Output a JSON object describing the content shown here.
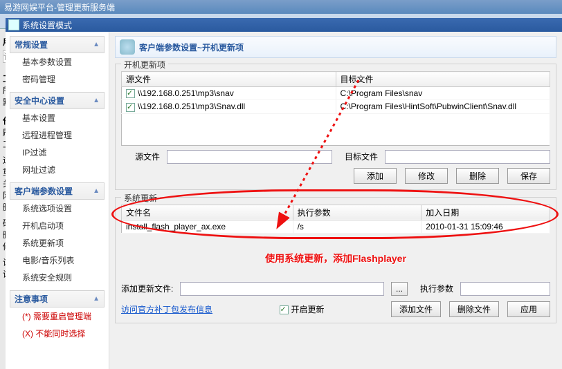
{
  "app_title": "易游网娱平台-管理更新服务端",
  "modal_title": "系统设置模式",
  "left": {
    "user_hdr": "用户设",
    "input_ph": "请输",
    "sect1": "工作纟",
    "l1": "所有工",
    "l2": "默认纟",
    "sect2": "任务",
    "l3": "刷新工",
    "l4": "工作纟",
    "l5": "运行和",
    "l6": "重启工",
    "l7": "关闭工",
    "l8": "网络发",
    "l9": "删除文",
    "l10": "硬盘保",
    "l11": "删除工",
    "l12": "修改工",
    "l13": "设备和",
    "l14": "设备管"
  },
  "sidebar": {
    "g1": "常规设置",
    "g1_items": [
      "基本参数设置",
      "密码管理"
    ],
    "g2": "安全中心设置",
    "g2_items": [
      "基本设置",
      "远程进程管理",
      "IP过滤",
      "网址过滤"
    ],
    "g3": "客户端参数设置",
    "g3_items": [
      "系统选项设置",
      "开机启动项",
      "系统更新项",
      "电影/音乐列表",
      "系统安全规则"
    ],
    "g4": "注意事项",
    "g4_items": [
      "(*) 需要重启管理端",
      "(X) 不能同时选择"
    ]
  },
  "crumb": "客户端参数设置~开机更新项",
  "sec1": {
    "title": "开机更新项",
    "cols": [
      "源文件",
      "目标文件"
    ],
    "rows": [
      {
        "src": "\\\\192.168.0.251\\mp3\\snav",
        "dst": "C:\\Program Files\\snav"
      },
      {
        "src": "\\\\192.168.0.251\\mp3\\Snav.dll",
        "dst": "C:\\Program Files\\HintSoft\\PubwinClient\\Snav.dll"
      }
    ],
    "lbl_src": "源文件",
    "lbl_dst": "目标文件",
    "btn_add": "添加",
    "btn_mod": "修改",
    "btn_del": "删除",
    "btn_save": "保存"
  },
  "sec2": {
    "title": "系统更新",
    "cols": [
      "文件名",
      "执行参数",
      "加入日期"
    ],
    "rows": [
      {
        "name": "install_flash_player_ax.exe",
        "param": "/s",
        "date": "2010-01-31 15:09:46"
      }
    ],
    "annot": "使用系统更新，添加Flashplayer",
    "lbl_addfile": "添加更新文件:",
    "lbl_param": "执行参数",
    "link": "访问官方补丁包发布信息",
    "chk_start": "开启更新",
    "btn_addfile": "添加文件",
    "btn_delfile": "删除文件",
    "btn_apply": "应用"
  }
}
